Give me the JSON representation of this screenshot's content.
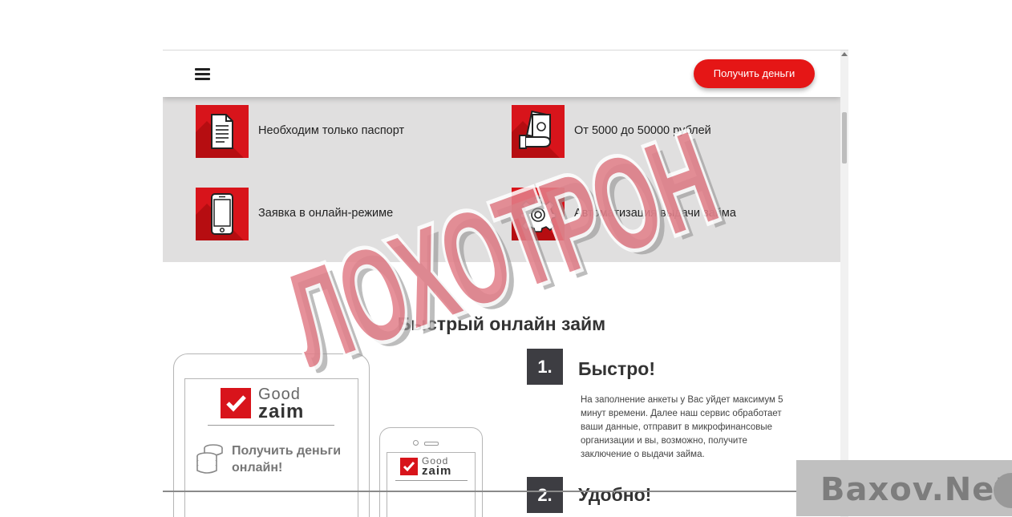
{
  "header": {
    "menu_icon": "hamburger-menu-icon",
    "cta_label": "Получить деньги",
    "accent_color": "#e51616"
  },
  "features": [
    {
      "label": "Необходим только паспорт",
      "icon": "document-icon"
    },
    {
      "label": "От 5000 до 50000 рублей",
      "icon": "money-in-hand-icon"
    },
    {
      "label": "Заявка в онлайн-режиме",
      "icon": "smartphone-icon"
    },
    {
      "label": "Автоматизация выдачи займа",
      "icon": "gear-icon"
    }
  ],
  "section": {
    "title": "Быстрый онлайн займ",
    "steps": [
      {
        "number": "1.",
        "title": "Быстро!",
        "text": "На заполнение анкеты у Вас уйдет максимум 5 минут времени. Далее наш сервис обработает ваши данные, отправит в микрофинансовые организации и вы, возможно, получите заключение о выдачи займа."
      },
      {
        "number": "2.",
        "title": "Удобно!"
      }
    ]
  },
  "device_logo": {
    "good": "Good",
    "zaim": "zaim",
    "get_money": "Получить деньги онлайн!"
  },
  "stamp": {
    "text": "ЛОХОТРОН",
    "color": "#d8141b"
  },
  "watermark": {
    "text": "Baxov.Net"
  }
}
